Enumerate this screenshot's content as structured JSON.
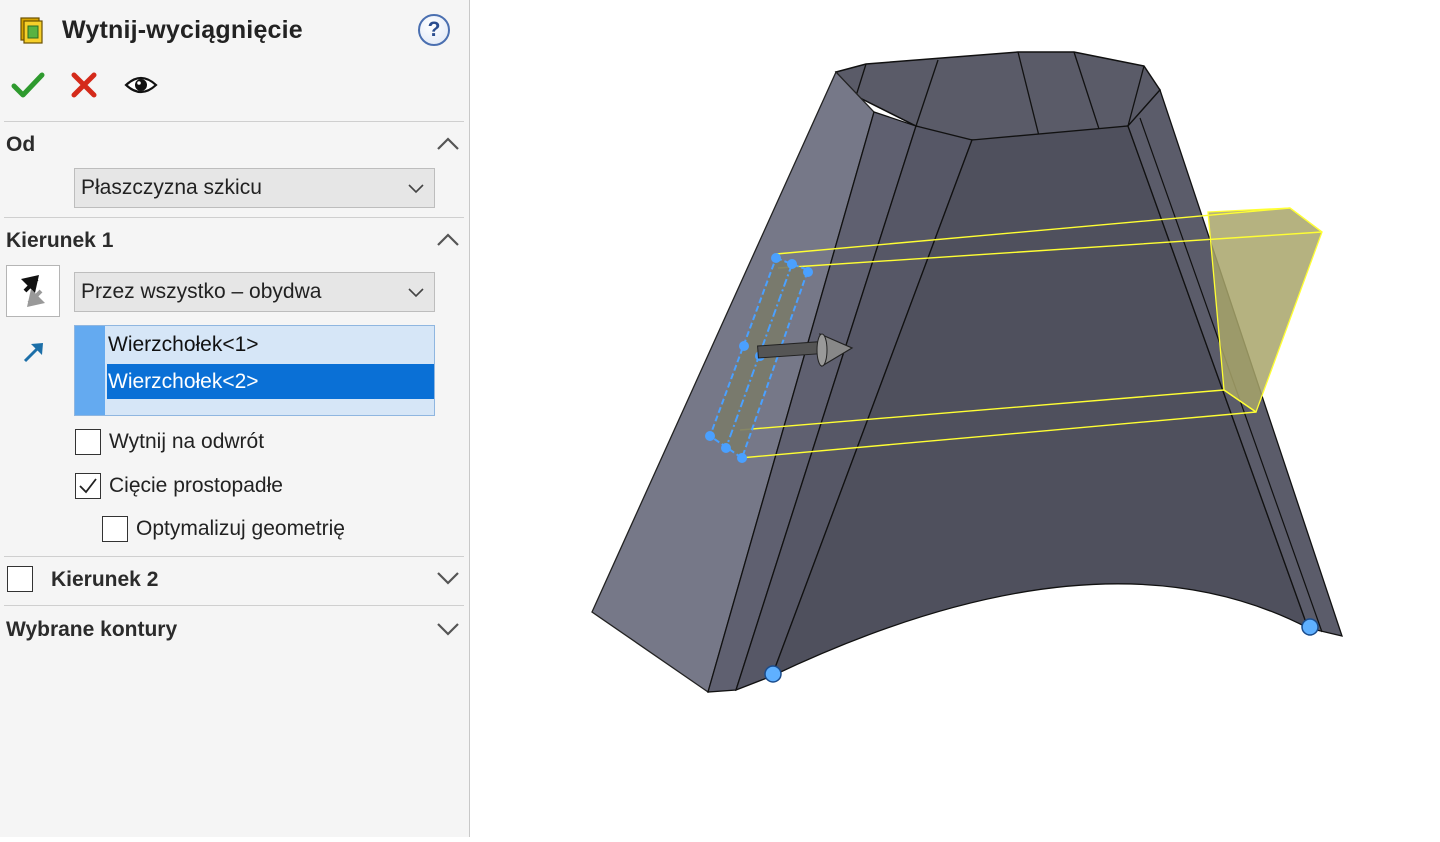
{
  "panel": {
    "title": "Wytnij-wyciągnięcie",
    "help_label": "?",
    "sections": {
      "from": {
        "title": "Od",
        "dropdown_value": "Płaszczyzna szkicu"
      },
      "direction1": {
        "title": "Kierunek 1",
        "end_condition": "Przez wszystko – obydwa",
        "list_items": [
          "Wierzchołek<1>",
          "Wierzchołek<2>"
        ],
        "selected_index": 1,
        "flip_side_label": "Wytnij na odwrót",
        "flip_side_checked": false,
        "normal_cut_label": "Cięcie prostopadłe",
        "normal_cut_checked": true,
        "optimize_label": "Optymalizuj geometrię",
        "optimize_checked": false
      },
      "direction2": {
        "title": "Kierunek 2",
        "checked": false
      },
      "contours": {
        "title": "Wybrane kontury"
      }
    }
  },
  "colors": {
    "accept": "#2e9a2e",
    "cancel": "#d42a1a",
    "selection": "#0a70d6",
    "list_bg": "#d6e6f7",
    "preview_yellow": "#ffff33",
    "model_face": "#52535f",
    "sketch_blue": "#4aa0ff"
  },
  "icons": [
    "cut-extrude-feature-icon",
    "help-icon",
    "ok-checkmark-icon",
    "cancel-x-icon",
    "preview-eye-icon",
    "reverse-direction-icon",
    "vertex-arrow-icon",
    "chevron-up-icon",
    "chevron-down-icon"
  ]
}
